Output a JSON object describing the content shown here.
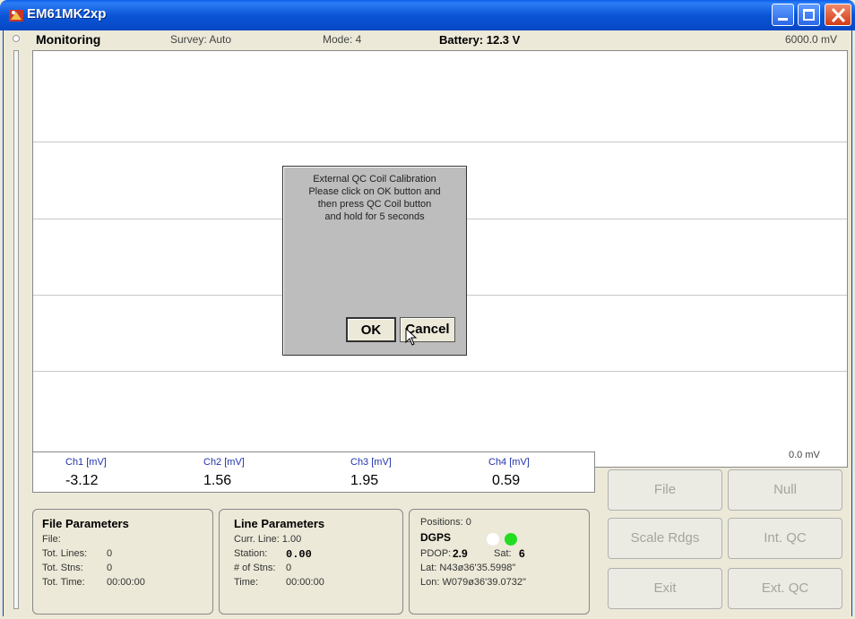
{
  "window": {
    "title": "EM61MK2xp"
  },
  "status": {
    "monitoring": "Monitoring",
    "survey": "Survey: Auto",
    "mode": "Mode: 4",
    "battery": "Battery: 12.3 V",
    "scale_top": "6000.0 mV",
    "scale_bottom": "0.0 mV"
  },
  "dialog": {
    "line1": "External QC Coil Calibration",
    "line2": "Please click on OK button and",
    "line3": "then press QC Coil button",
    "line4": "and hold for 5 seconds",
    "ok": "OK",
    "cancel": "Cancel"
  },
  "channels": [
    {
      "label": "Ch1 [mV]",
      "value": "-3.12"
    },
    {
      "label": "Ch2 [mV]",
      "value": "1.56"
    },
    {
      "label": "Ch3 [mV]",
      "value": "1.95"
    },
    {
      "label": "Ch4 [mV]",
      "value": "0.59"
    }
  ],
  "file_params": {
    "title": "File Parameters",
    "file": "File:",
    "tot_lines_label": "Tot. Lines:",
    "tot_lines": "0",
    "tot_stns_label": "Tot. Stns:",
    "tot_stns": "0",
    "tot_time_label": "Tot. Time:",
    "tot_time": "00:00:00"
  },
  "line_params": {
    "title": "Line Parameters",
    "curr_line": "Curr. Line: 1.00",
    "station_label": "Station:",
    "station": "0.00",
    "num_stns_label": "# of Stns:",
    "num_stns": "0",
    "time_label": "Time:",
    "time": "00:00:00"
  },
  "positions": {
    "positions": "Positions: 0",
    "dgps": "DGPS",
    "pdop_label": "PDOP:",
    "pdop": "2.9",
    "sat_label": "Sat:",
    "sat": "6",
    "lat": "Lat: N43ø36'35.5998\"",
    "lon": "Lon: W079ø36'39.0732\""
  },
  "buttons": {
    "file": "File",
    "null": "Null",
    "scale_rdgs": "Scale Rdgs",
    "int_qc": "Int. QC",
    "exit": "Exit",
    "ext_qc": "Ext. QC"
  },
  "colors": {
    "dgps_off": "#ffffff",
    "dgps_on": "#22dd22",
    "title_bar": "#0a55d6"
  }
}
